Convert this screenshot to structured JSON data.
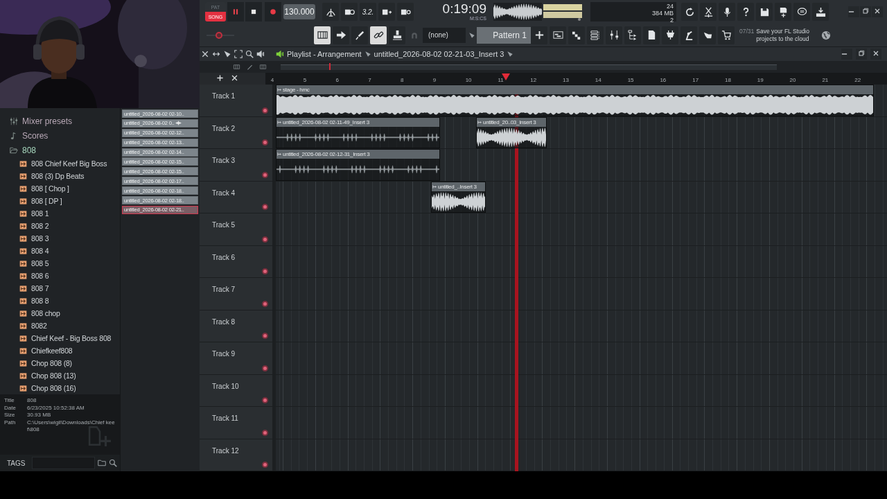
{
  "toolbar": {
    "mode": [
      {
        "label": "PAT",
        "selected": false
      },
      {
        "label": "SONG",
        "selected": true
      }
    ],
    "pitch_slider": {
      "level": 0.45
    },
    "playing": true,
    "tempo": "130.000",
    "step_label": "3.2.",
    "time_format": "M:S:CS",
    "time": "0:19:09",
    "cpu": "24",
    "memory": "384 MB",
    "polyphony": "2",
    "tools": [
      {
        "kind": "piano",
        "on": true
      },
      {
        "kind": "arrow",
        "on": false
      },
      {
        "kind": "paint",
        "on": false
      },
      {
        "kind": "link",
        "on": true
      },
      {
        "kind": "stamp",
        "on": false
      }
    ],
    "snap": "(none)",
    "pattern": "Pattern 1",
    "hint_counter": "07/31",
    "hint": "Save your FL Studio projects to the cloud"
  },
  "browser": {
    "items": [
      {
        "label": "Mixer presets",
        "kind": "mixer"
      },
      {
        "label": "Scores",
        "kind": "score"
      },
      {
        "label": "808",
        "kind": "folder",
        "children": [
          {
            "label": "808  Chief Keef Big Boss"
          },
          {
            "label": "808 (3) Dp Beats"
          },
          {
            "label": "808 [ Chop ]"
          },
          {
            "label": "808 [ DP ]"
          },
          {
            "label": "808 1"
          },
          {
            "label": "808 2"
          },
          {
            "label": "808 3"
          },
          {
            "label": "808 4"
          },
          {
            "label": "808 5"
          },
          {
            "label": "808 6"
          },
          {
            "label": "808 7"
          },
          {
            "label": "808 8"
          },
          {
            "label": "808 chop"
          },
          {
            "label": "8082"
          },
          {
            "label": "Chief Keef - Big Boss 808"
          },
          {
            "label": "Chiefkeef808"
          },
          {
            "label": "Chop 808 (8)"
          },
          {
            "label": "Chop 808 (13)"
          },
          {
            "label": "Chop 808 (16)"
          }
        ]
      }
    ],
    "recent": [
      {
        "label": "untitled_2026-08-02 02-10..",
        "selected": false
      },
      {
        "label": "untitled_2026-08-02 0..",
        "selected": false
      },
      {
        "label": "untitled_2026-08-02 02-12..",
        "selected": false
      },
      {
        "label": "untitled_2026-08-02 02-13..",
        "selected": false
      },
      {
        "label": "untitled_2026-08-02 02-14..",
        "selected": false
      },
      {
        "label": "untitled_2026-08-02 02-15..",
        "selected": false
      },
      {
        "label": "untitled_2026-08-02 02-15..",
        "selected": false
      },
      {
        "label": "untitled_2026-08-02 02-17..",
        "selected": false
      },
      {
        "label": "untitled_2026-08-02 02-18..",
        "selected": false
      },
      {
        "label": "untitled_2026-08-02 02-18..",
        "selected": false
      },
      {
        "label": "untitled_2026-08-02 02-21..",
        "selected": true
      }
    ],
    "info": [
      {
        "key": "Title",
        "value": "808"
      },
      {
        "key": "Date",
        "value": "6/23/2025 10:52:38 AM"
      },
      {
        "key": "Size",
        "value": "30.93 MB"
      },
      {
        "key": "Path",
        "value": "C:\\Users\\wigil\\Downloads\\Chief keef\\808"
      }
    ],
    "tags_label": "TAGS"
  },
  "playlist": {
    "title": "Playlist - Arrangement",
    "pattern": "untitled_2026-08-02 02-21-03_Insert 3",
    "ruler": [
      "4",
      "5",
      "6",
      "7",
      "8",
      "9",
      "10",
      "11",
      "12",
      "13",
      "14",
      "15",
      "16",
      "17",
      "18",
      "19",
      "20",
      "21",
      "22"
    ],
    "tracks": [
      {
        "name": "Track 1",
        "clips": [
          {
            "name": "stage - hmc",
            "kind": "loud"
          }
        ]
      },
      {
        "name": "Track 2",
        "clips": [
          {
            "name": "untitled_2026-08-02 02-11-49_Insert 3",
            "kind": "sparse"
          },
          {
            "name": "untitled_20..03_Insert 3",
            "kind": "dense"
          }
        ]
      },
      {
        "name": "Track 3",
        "clips": [
          {
            "name": "untitled_2026-08-02 02-12-31_Insert 3",
            "kind": "sparse"
          }
        ]
      },
      {
        "name": "Track 4",
        "clips": [
          {
            "name": "untitled_..Insert 3",
            "kind": "dense"
          }
        ]
      },
      {
        "name": "Track 5"
      },
      {
        "name": "Track 6"
      },
      {
        "name": "Track 7"
      },
      {
        "name": "Track 8"
      },
      {
        "name": "Track 9"
      },
      {
        "name": "Track 10"
      },
      {
        "name": "Track 11"
      },
      {
        "name": "Track 12"
      }
    ]
  }
}
